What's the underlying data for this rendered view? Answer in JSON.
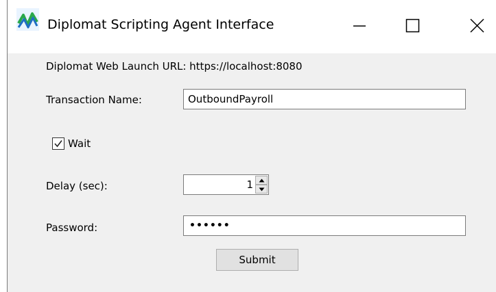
{
  "window": {
    "title": "Diplomat Scripting Agent Interface",
    "controls": [
      "minimize",
      "maximize",
      "close"
    ]
  },
  "form": {
    "launch_url_text": "Diplomat Web Launch URL: https://localhost:8080",
    "transaction_label": "Transaction Name:",
    "transaction_value": "OutboundPayroll",
    "wait_label": "Wait",
    "wait_checked": true,
    "delay_label": "Delay (sec):",
    "delay_value": "1",
    "password_label": "Password:",
    "password_mask": "••••••",
    "submit_label": "Submit"
  },
  "icons": {
    "app": "diplomat-app-icon",
    "minimize": "minimize-icon",
    "maximize": "maximize-icon",
    "close": "close-icon"
  },
  "colors": {
    "content_bg": "#f0f0f0",
    "icon_green": "#2aa84a",
    "icon_blue": "#1f6fc4"
  }
}
